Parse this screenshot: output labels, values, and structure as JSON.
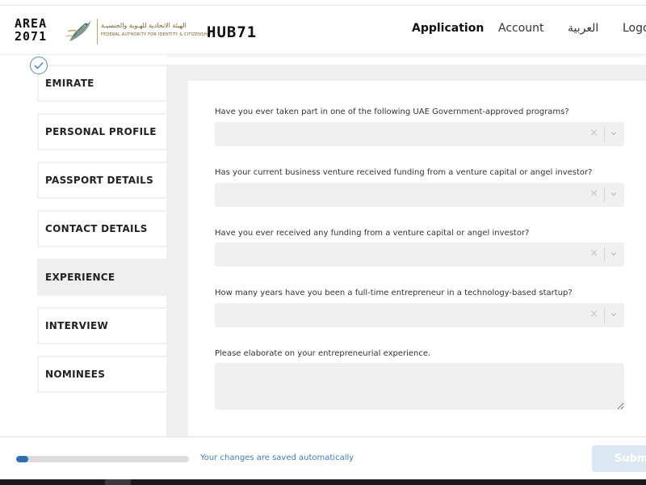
{
  "header": {
    "logo_area_line1": "AREA",
    "logo_area_line2": "2071",
    "ica_arabic": "الهيئة الاتحادية للهـوية والجنسيـة",
    "ica_english": "FEDERAL AUTHORITY FOR IDENTITY & CITIZENSHIP",
    "logo_hub": "HUB71",
    "nav": {
      "application": "Application",
      "account": "Account",
      "arabic": "العربية",
      "logout": "Logout"
    }
  },
  "steps": [
    {
      "label": "EMIRATE",
      "completed": true
    },
    {
      "label": "PERSONAL PROFILE"
    },
    {
      "label": "PASSPORT DETAILS"
    },
    {
      "label": "CONTACT DETAILS"
    },
    {
      "label": "EXPERIENCE",
      "active": true
    },
    {
      "label": "INTERVIEW"
    },
    {
      "label": "NOMINEES"
    }
  ],
  "form": {
    "questions": [
      {
        "label": "Have you ever taken part in one of the following UAE Government-approved programs?",
        "value": ""
      },
      {
        "label": "Has your current business venture received funding from a venture capital or angel investor?",
        "value": ""
      },
      {
        "label": "Have you ever received any funding from a venture capital or angel investor?",
        "value": ""
      },
      {
        "label": "How many years have you been a full-time entrepreneur in a technology-based startup?",
        "value": ""
      }
    ],
    "elaborate_label": "Please elaborate on your entrepreneurial experience.",
    "elaborate_value": "",
    "clear_glyph": "×"
  },
  "footer": {
    "progress_fraction": 0.07,
    "saved_text": "Your changes are saved automatically",
    "submit_label": "Submit"
  },
  "colors": {
    "accent": "#2d6fb5",
    "link": "#3f7bb9",
    "submit_disabled": "#dbe7f3",
    "field_bg": "#f0f0f0"
  }
}
